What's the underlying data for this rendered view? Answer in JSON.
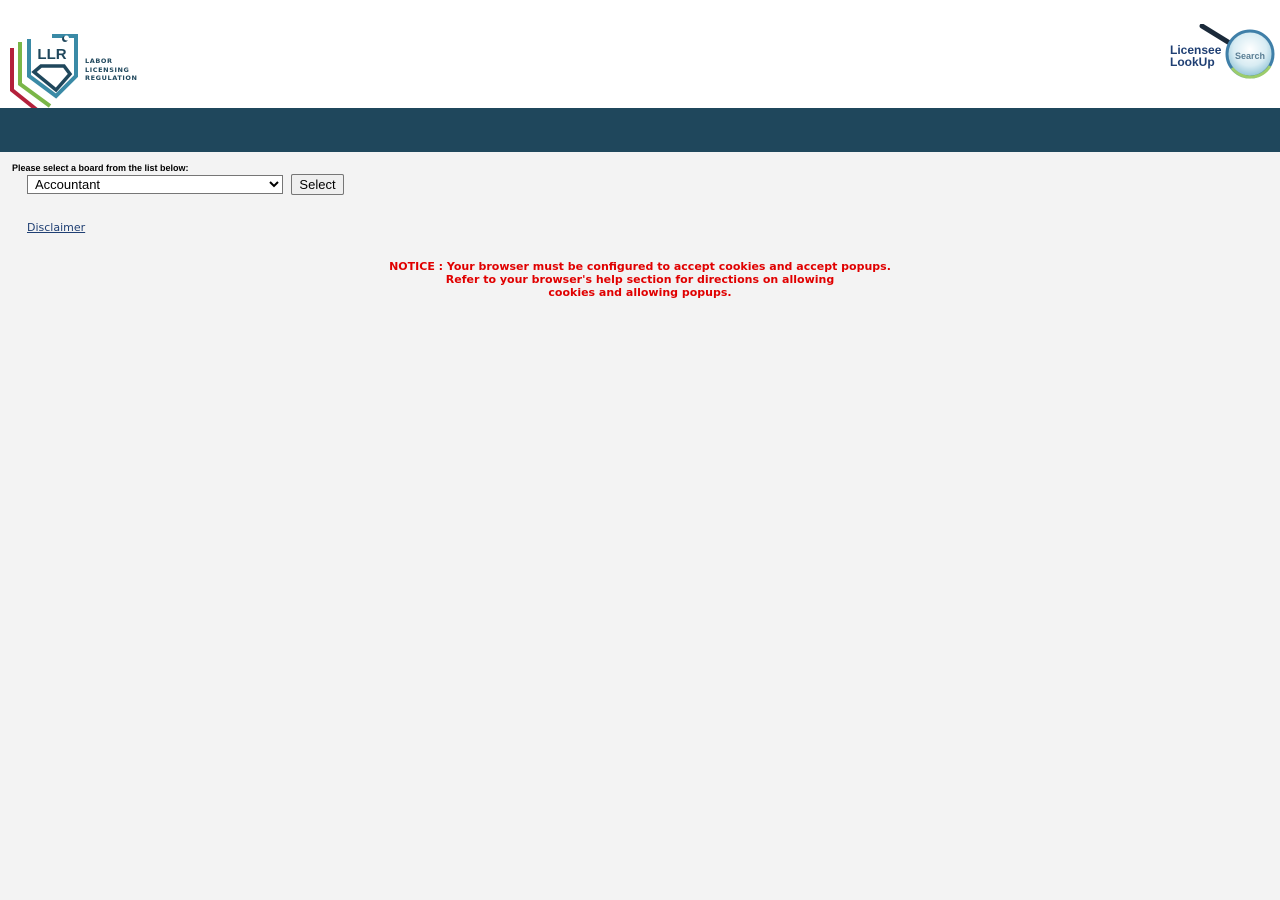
{
  "header": {
    "logo": {
      "abbrev": "LLR",
      "lines": [
        "LABOR",
        "LICENSING",
        "REGULATION"
      ]
    },
    "lookup": {
      "line1": "Licensee",
      "line2": "LookUp",
      "search_label": "Search"
    }
  },
  "form": {
    "prompt": "Please select a board from the list below:",
    "board_select": {
      "selected": "Accountant",
      "options": [
        "Accountant"
      ]
    },
    "select_button": "Select"
  },
  "links": {
    "disclaimer": "Disclaimer"
  },
  "notice": {
    "line1": "NOTICE : Your browser must be configured to accept cookies and accept popups.",
    "line2": "Refer to your browser's help section for directions on allowing",
    "line3": "cookies and allowing popups."
  },
  "colors": {
    "brand_bar": "#1f475c",
    "notice": "#e00000",
    "link": "#1f3f73",
    "background": "#f3f3f3"
  }
}
